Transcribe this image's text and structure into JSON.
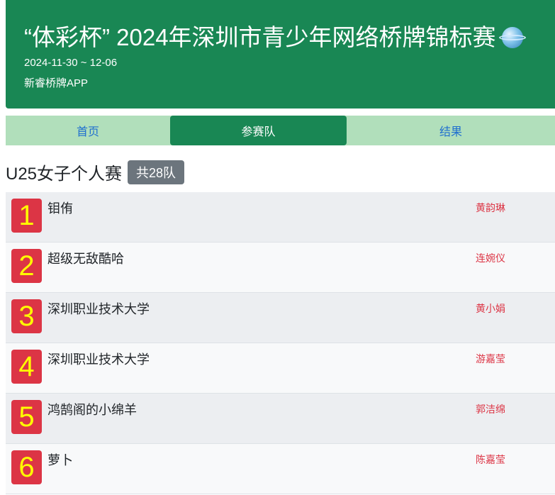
{
  "header": {
    "title": "“体彩杯” 2024年深圳市青少年网络桥牌锦标赛",
    "icon": "globe-icon",
    "dates": "2024-11-30 ~ 12-06",
    "org": "新睿桥牌APP"
  },
  "tabs": [
    {
      "label": "首页",
      "active": false
    },
    {
      "label": "参赛队",
      "active": true
    },
    {
      "label": "结果",
      "active": false
    }
  ],
  "section": {
    "title": "U25女子个人赛",
    "count_badge": "共28队"
  },
  "teams": [
    {
      "rank": "1",
      "name": "钼侑",
      "player": "黄韵琳"
    },
    {
      "rank": "2",
      "name": "超级无敌酷哈",
      "player": "连婉仪"
    },
    {
      "rank": "3",
      "name": "深圳职业技术大学",
      "player": "黄小娟"
    },
    {
      "rank": "4",
      "name": "深圳职业技术大学",
      "player": "游嘉莹"
    },
    {
      "rank": "5",
      "name": "鸿鹄阁的小绵羊",
      "player": "郭洁绵"
    },
    {
      "rank": "6",
      "name": "萝卜",
      "player": "陈嘉莹"
    }
  ],
  "colors": {
    "header_bg": "#198754",
    "tabs_bg": "#b1dfbb",
    "rank_bg": "#dc3545",
    "rank_text": "#ffff00",
    "player_text": "#dc3545"
  }
}
